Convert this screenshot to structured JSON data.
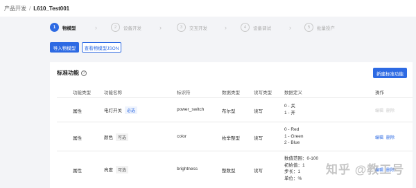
{
  "breadcrumb": {
    "parent": "产品开发",
    "separator": "/",
    "current": "L610_Test001"
  },
  "steps": [
    {
      "num": "1",
      "label": "物模型"
    },
    {
      "num": "2",
      "label": "设备开发"
    },
    {
      "num": "3",
      "label": "交互开发"
    },
    {
      "num": "4",
      "label": "设备调试"
    },
    {
      "num": "5",
      "label": "批量投产"
    }
  ],
  "toolbar": {
    "import_label": "导入物模型",
    "view_json_label": "查看物模型JSON"
  },
  "card": {
    "title": "标准功能",
    "help": "?",
    "new_button": "新建标准功能"
  },
  "table": {
    "headers": [
      "功能类型",
      "功能名称",
      "标识符",
      "数据类型",
      "读写类型",
      "数据定义",
      "操作"
    ],
    "rows": [
      {
        "type": "属性",
        "name": "电灯开关",
        "tag": "必选",
        "id": "power_switch",
        "dtype": "布尔型",
        "rw": "读写",
        "def": [
          "0 - 关",
          "1 - 开"
        ],
        "edit": "编辑",
        "delete": "删除"
      },
      {
        "type": "属性",
        "name": "颜色",
        "tag": "可选",
        "id": "color",
        "dtype": "枚举整型",
        "rw": "读写",
        "def": [
          "0 - Red",
          "1 - Green",
          "2 - Blue"
        ],
        "edit": "编辑",
        "delete": "删除"
      },
      {
        "type": "属性",
        "name": "亮度",
        "tag": "可选",
        "id": "brightness",
        "dtype": "整数型",
        "rw": "读写",
        "def": [
          "数值范围：0-100",
          "初始值：1",
          "步长：1",
          "单位：%"
        ],
        "edit": "编辑",
        "delete": "删除"
      }
    ]
  },
  "watermark": "知乎 @教工号",
  "colors": {
    "primary": "#2d6ae3",
    "background": "#f3f4f7"
  }
}
